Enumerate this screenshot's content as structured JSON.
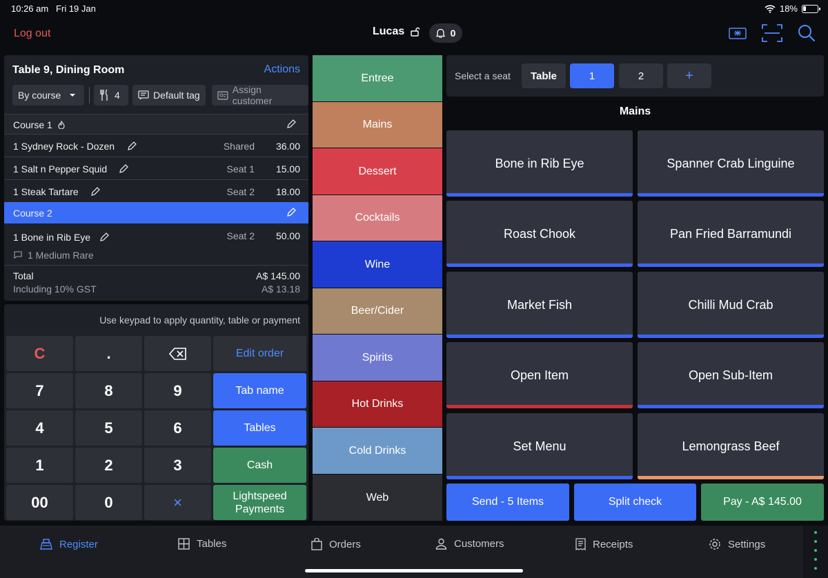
{
  "status": {
    "time": "10:26 am",
    "date": "Fri 19 Jan",
    "battery": "18%"
  },
  "header": {
    "logout": "Log out",
    "user": "Lucas",
    "notifications": "0"
  },
  "order": {
    "title": "Table 9, Dining Room",
    "actions": "Actions",
    "by_course": "By course",
    "covers": "4",
    "default_tag": "Default tag",
    "assign_customer": "Assign customer",
    "course1": "Course 1",
    "course2": "Course 2",
    "items": [
      {
        "name": "1  Sydney Rock - Dozen",
        "seat": "Shared",
        "price": "36.00"
      },
      {
        "name": "1  Salt n Pepper Squid",
        "seat": "Seat 1",
        "price": "15.00"
      },
      {
        "name": "1  Steak Tartare",
        "seat": "Seat 2",
        "price": "18.00"
      },
      {
        "name": "1  Bone in Rib Eye",
        "seat": "Seat 2",
        "price": "50.00",
        "modifier": "1  Medium Rare"
      }
    ],
    "total_label": "Total",
    "total": "A$ 145.00",
    "gst_label": "Including 10% GST",
    "gst": "A$ 13.18"
  },
  "keypad": {
    "hint": "Use keypad to apply quantity, table or payment",
    "clear": "C",
    "dot": ".",
    "keys": [
      "7",
      "8",
      "9",
      "4",
      "5",
      "6",
      "1",
      "2",
      "3",
      "00",
      "0"
    ],
    "times": "×",
    "edit_order": "Edit order",
    "tab_name": "Tab name",
    "tables": "Tables",
    "cash": "Cash",
    "lightspeed": "Lightspeed Payments"
  },
  "categories": [
    {
      "label": "Entree",
      "color": "#4c9a72"
    },
    {
      "label": "Mains",
      "color": "#c0805d"
    },
    {
      "label": "Dessert",
      "color": "#d7404b"
    },
    {
      "label": "Cocktails",
      "color": "#d67c80"
    },
    {
      "label": "Wine",
      "color": "#1e3cd1"
    },
    {
      "label": "Beer/Cider",
      "color": "#a88a6c"
    },
    {
      "label": "Spirits",
      "color": "#6f79d0"
    },
    {
      "label": "Hot Drinks",
      "color": "#a72126"
    },
    {
      "label": "Cold Drinks",
      "color": "#6d99c8"
    },
    {
      "label": "Web",
      "color": "#2b2d33"
    }
  ],
  "seats": {
    "label": "Select a seat",
    "table": "Table",
    "one": "1",
    "two": "2",
    "add": "+"
  },
  "section": "Mains",
  "menu_items": [
    {
      "label": "Bone in Rib Eye",
      "bar": "#3d64f0"
    },
    {
      "label": "Spanner Crab Linguine",
      "bar": "#3d64f0"
    },
    {
      "label": "Roast Chook",
      "bar": "#3d64f0"
    },
    {
      "label": "Pan Fried Barramundi",
      "bar": "#3d64f0"
    },
    {
      "label": "Market Fish",
      "bar": "#3d64f0"
    },
    {
      "label": "Chilli Mud Crab",
      "bar": "#3d64f0"
    },
    {
      "label": "Open Item",
      "bar": "#c8303a"
    },
    {
      "label": "Open Sub-Item",
      "bar": "#3d64f0"
    },
    {
      "label": "Set Menu",
      "bar": "#3d64f0"
    },
    {
      "label": "Lemongrass Beef",
      "bar": "#e8976a"
    }
  ],
  "bottom": {
    "send": "Send - 5 Items",
    "split": "Split check",
    "pay": "Pay - A$ 145.00"
  },
  "nav": [
    "Register",
    "Tables",
    "Orders",
    "Customers",
    "Receipts",
    "Settings"
  ],
  "colors": {
    "accent": "#3b6cf6",
    "green": "#3a8a5e",
    "danger": "#e65a55"
  }
}
